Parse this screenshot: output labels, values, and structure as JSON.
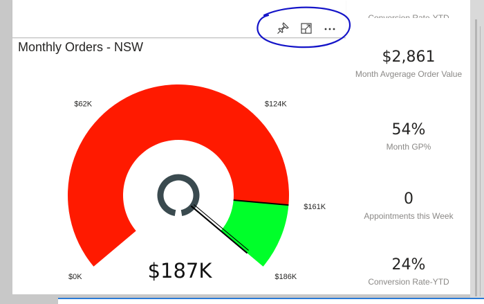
{
  "visual": {
    "title": "Monthly Orders - NSW",
    "toolbar": {
      "pin_icon": "pin-icon",
      "focus_icon": "focus-mode-icon",
      "more_icon": "more-options-icon"
    },
    "annotation_color": "#1414c8"
  },
  "chart_data": {
    "type": "gauge",
    "min": 0,
    "max": 186,
    "unit": "K",
    "value": 187,
    "value_label": "$187K",
    "target_start": 161,
    "tick_labels": [
      {
        "value": 0,
        "label": "$0K"
      },
      {
        "value": 62,
        "label": "$62K"
      },
      {
        "value": 124,
        "label": "$124K"
      },
      {
        "value": 161,
        "label": "$161K"
      },
      {
        "value": 186,
        "label": "$186K"
      }
    ],
    "colors": {
      "fill": "#ff1a00",
      "target_band": "#00ff2a",
      "hub": "#3a4a4f"
    }
  },
  "kpis": {
    "cut_off_label": "Conversion Rate-YTD",
    "items": [
      {
        "value": "$2,861",
        "label": "Month Avgerage Order Value"
      },
      {
        "value": "54%",
        "label": "Month GP%"
      },
      {
        "value": "0",
        "label": "Appointments this Week"
      },
      {
        "value": "24%",
        "label": "Conversion Rate-YTD"
      }
    ]
  }
}
